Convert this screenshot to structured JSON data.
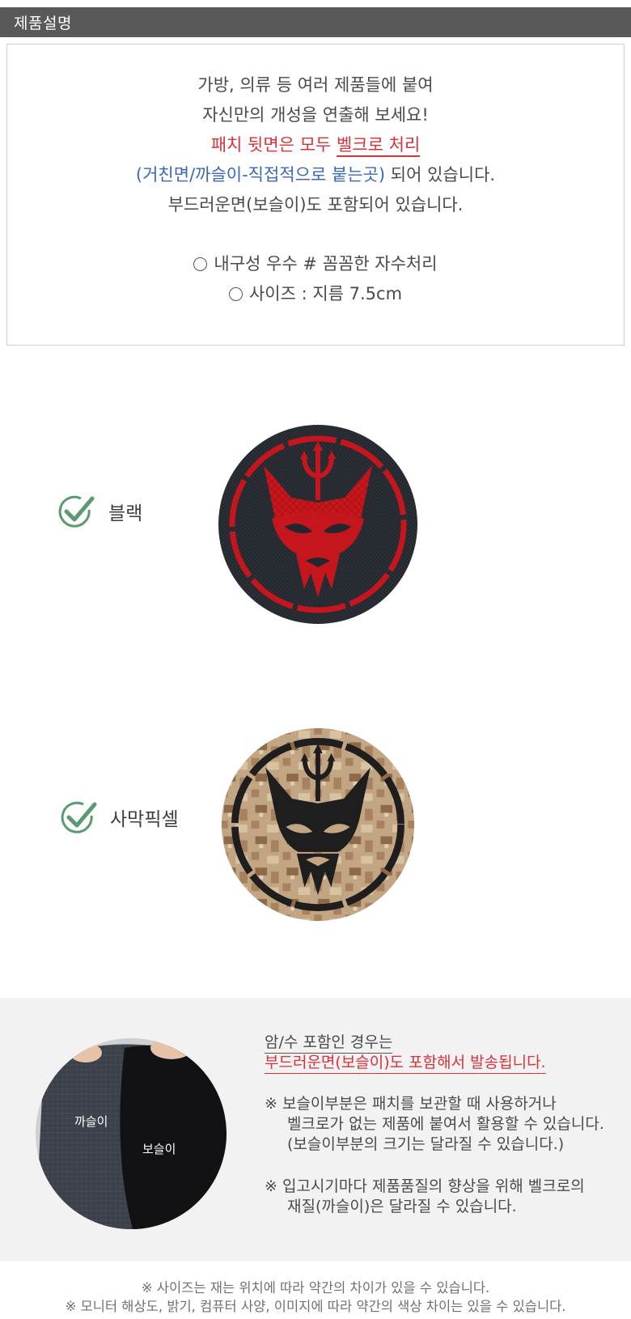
{
  "header": {
    "title": "제품설명"
  },
  "description": {
    "line1": "가방, 의류 등 여러 제품들에 붙여",
    "line2": "자신만의 개성을 연출해 보세요!",
    "line3_prefix": "패치 뒷면은 모두 ",
    "line3_highlight": "벨크로 처리",
    "line4_blue": "(거친면/까슬이-직접적으로 붙는곳)",
    "line4_rest": " 되어 있습니다.",
    "line5": "부드러운면(보슬이)도 포함되어 있습니다.",
    "feature1": "내구성 우수  # 꼼꼼한 자수처리",
    "feature2": "사이즈 : 지름 7.5cm"
  },
  "variants": [
    {
      "label": "블랙",
      "color": "#c4161c",
      "base": "#22262c"
    },
    {
      "label": "사막픽셀",
      "color": "#1e1e1e",
      "base": "#b89a78"
    }
  ],
  "velcro": {
    "photo_label_rough": "까슬이",
    "photo_label_soft": "보슬이",
    "title1": "암/수 포함인 경우는",
    "title2": "부드러운면(보슬이)도 포함해서 발송됩니다.",
    "note1_line1": "※ 보슬이부분은 패치를 보관할 때 사용하거나",
    "note1_line2": "벨크로가 없는 제품에 붙여서 활용할 수 있습니다.",
    "note1_line3": "(보슬이부분의 크기는 달라질 수 있습니다.)",
    "note2_line1": "※ 입고시기마다  제품품질의 향상을 위해 벨크로의",
    "note2_line2": "재질(까슬이)은 달라질 수 있습니다."
  },
  "footer": {
    "note1": "※ 사이즈는 재는 위치에 따라 약간의 차이가 있을 수 있습니다.",
    "note2": "※ 모니터 해상도, 밝기, 컴퓨터 사양, 이미지에 따라 약간의 색상 차이는 있을 수 있습니다."
  },
  "colors": {
    "header_bg": "#595959",
    "accent_red": "#d8323a",
    "accent_blue": "#3a68b8",
    "check_green": "#5a9a6e"
  }
}
